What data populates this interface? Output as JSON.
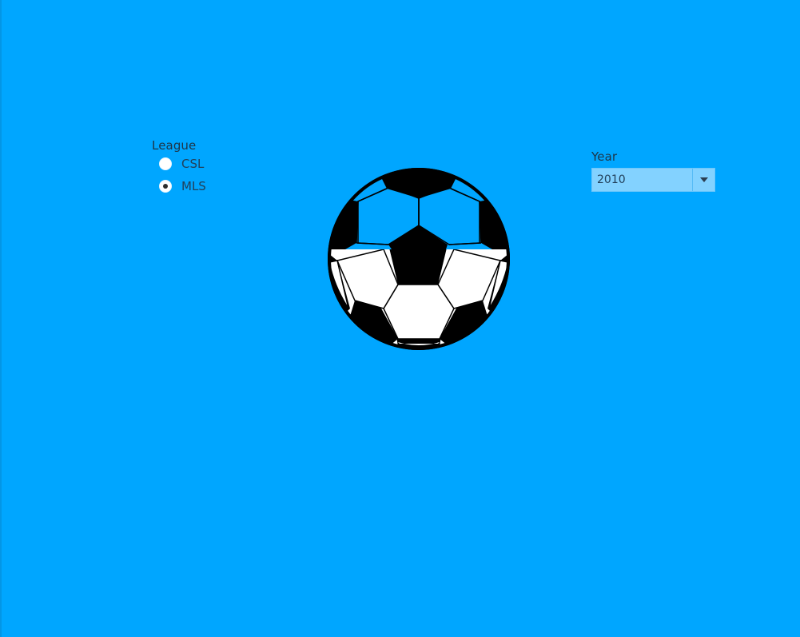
{
  "league_filter": {
    "title": "League",
    "options": [
      {
        "label": "CSL",
        "selected": false
      },
      {
        "label": "MLS",
        "selected": true
      }
    ]
  },
  "year_filter": {
    "title": "Year",
    "value": "2010"
  },
  "colors": {
    "background": "#00a6ff",
    "dropdown": "#83d2ff",
    "ball_black": "#000000",
    "ball_white": "#ffffff"
  },
  "icons": {
    "ball": "soccer-ball",
    "dropdown": "chevron-down-icon"
  }
}
